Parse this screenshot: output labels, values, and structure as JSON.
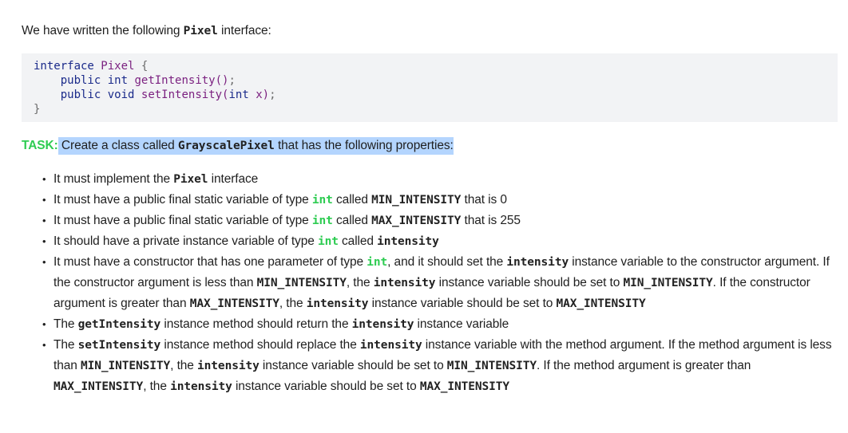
{
  "intro": {
    "before": "We have written the following ",
    "code": "Pixel",
    "after": " interface:"
  },
  "code_block": {
    "lines": [
      [
        {
          "t": "interface",
          "c": "kw"
        },
        {
          "t": " ",
          "c": ""
        },
        {
          "t": "Pixel",
          "c": "id"
        },
        {
          "t": " {",
          "c": "pn"
        }
      ],
      [
        {
          "t": "    ",
          "c": ""
        },
        {
          "t": "public",
          "c": "kw"
        },
        {
          "t": " ",
          "c": ""
        },
        {
          "t": "int",
          "c": "kw"
        },
        {
          "t": " ",
          "c": ""
        },
        {
          "t": "getIntensity()",
          "c": "id"
        },
        {
          "t": ";",
          "c": "pn"
        }
      ],
      [
        {
          "t": "    ",
          "c": ""
        },
        {
          "t": "public",
          "c": "kw"
        },
        {
          "t": " ",
          "c": ""
        },
        {
          "t": "void",
          "c": "kw"
        },
        {
          "t": " ",
          "c": ""
        },
        {
          "t": "setIntensity(",
          "c": "id"
        },
        {
          "t": "int",
          "c": "kw"
        },
        {
          "t": " ",
          "c": ""
        },
        {
          "t": "x)",
          "c": "id"
        },
        {
          "t": ";",
          "c": "pn"
        }
      ],
      [
        {
          "t": "}",
          "c": "pn"
        }
      ]
    ]
  },
  "task": {
    "label": "TASK:",
    "before": " Create a class called ",
    "class_name": "GrayscalePixel",
    "after": " that has the following properties:"
  },
  "properties": [
    [
      {
        "t": "It must implement the "
      },
      {
        "t": "Pixel",
        "s": "code"
      },
      {
        "t": " interface"
      }
    ],
    [
      {
        "t": "It must have a public final static variable of type "
      },
      {
        "t": "int",
        "s": "type"
      },
      {
        "t": " called "
      },
      {
        "t": "MIN_INTENSITY",
        "s": "code"
      },
      {
        "t": " that is 0"
      }
    ],
    [
      {
        "t": "It must have a public final static variable of type "
      },
      {
        "t": "int",
        "s": "type"
      },
      {
        "t": " called "
      },
      {
        "t": "MAX_INTENSITY",
        "s": "code"
      },
      {
        "t": " that is 255"
      }
    ],
    [
      {
        "t": "It should have a private instance variable of type "
      },
      {
        "t": "int",
        "s": "type"
      },
      {
        "t": " called "
      },
      {
        "t": "intensity",
        "s": "code"
      }
    ],
    [
      {
        "t": "It must have a constructor that has one parameter of type "
      },
      {
        "t": "int",
        "s": "type"
      },
      {
        "t": ", and it should set the "
      },
      {
        "t": "intensity",
        "s": "code"
      },
      {
        "t": " instance variable to the constructor argument. If the constructor argument is less than "
      },
      {
        "t": "MIN_INTENSITY",
        "s": "code"
      },
      {
        "t": ", the "
      },
      {
        "t": "intensity",
        "s": "code"
      },
      {
        "t": " instance variable should be set to "
      },
      {
        "t": "MIN_INTENSITY",
        "s": "code"
      },
      {
        "t": ". If the constructor argument is greater than "
      },
      {
        "t": "MAX_INTENSITY",
        "s": "code"
      },
      {
        "t": ", the "
      },
      {
        "t": "intensity",
        "s": "code"
      },
      {
        "t": " instance variable should be set to "
      },
      {
        "t": "MAX_INTENSITY",
        "s": "code"
      }
    ],
    [
      {
        "t": "The "
      },
      {
        "t": "getIntensity",
        "s": "code"
      },
      {
        "t": " instance method should return the "
      },
      {
        "t": "intensity",
        "s": "code"
      },
      {
        "t": " instance variable"
      }
    ],
    [
      {
        "t": "The "
      },
      {
        "t": "setIntensity",
        "s": "code"
      },
      {
        "t": " instance method should replace the "
      },
      {
        "t": "intensity",
        "s": "code"
      },
      {
        "t": " instance variable with the method argument. If the method argument is less than "
      },
      {
        "t": "MIN_INTENSITY",
        "s": "code"
      },
      {
        "t": ", the "
      },
      {
        "t": "intensity",
        "s": "code"
      },
      {
        "t": " instance variable should be set to "
      },
      {
        "t": "MIN_INTENSITY",
        "s": "code"
      },
      {
        "t": ". If the method argument is greater than "
      },
      {
        "t": "MAX_INTENSITY",
        "s": "code"
      },
      {
        "t": ", the "
      },
      {
        "t": "intensity",
        "s": "code"
      },
      {
        "t": " instance variable should be set to "
      },
      {
        "t": "MAX_INTENSITY",
        "s": "code"
      }
    ]
  ],
  "bullet_glyph": "•",
  "colors": {
    "task_label": "#2ecc52",
    "type_keyword": "#2ecc52",
    "code_keyword": "#1a2a8a",
    "code_identifier": "#7a1f7f",
    "code_background": "#f2f3f5",
    "selection": "#b4d5fe"
  }
}
